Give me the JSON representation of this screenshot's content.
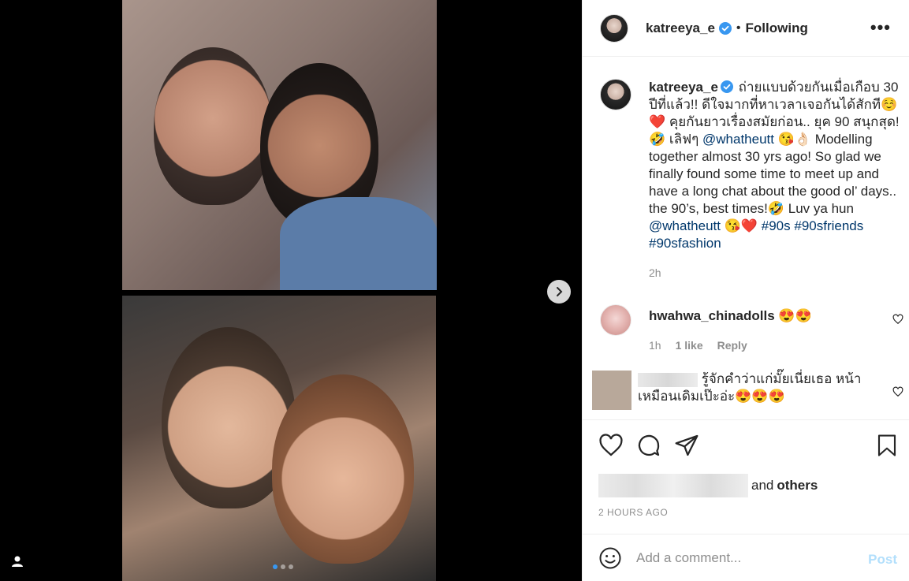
{
  "header": {
    "username": "katreeya_e",
    "separator": "•",
    "follow_status": "Following",
    "more": "•••"
  },
  "caption": {
    "username": "katreeya_e",
    "text_1": " ถ่ายแบบด้วยกันเมื่อเกือบ 30 ปีที่แล้ว!! ดีใจมากที่หาเวลาเจอกันได้สักที☺️❤️ คุยกันยาวเรื่องสมัยก่อน.. ยุค 90 สนุกสุด! 🤣 เลิฟๆ ",
    "mention_1": "@whatheutt",
    "text_2": " 😘👌🏻 Modelling together almost 30 yrs ago! So glad we finally found some time to meet up and have a long chat about the good ol’ days.. the 90’s, best times!🤣 Luv ya hun ",
    "mention_2": "@whatheutt",
    "text_3": " 😘❤️ ",
    "tag_1": "#90s",
    "tag_2": "#90sfriends",
    "tag_3": "#90sfashion",
    "time": "2h"
  },
  "comments": [
    {
      "username": "hwahwa_chinadolls",
      "text": " 😍😍",
      "time": "1h",
      "likes": "1 like",
      "reply": "Reply"
    },
    {
      "text": "รู้จักคำว่าแก่มั๊ยเนี่ยเธอ หน้าเหมือนเดิมเป๊ะอ่ะ😍😍😍"
    }
  ],
  "likes": {
    "suffix": "and",
    "others": "others"
  },
  "timestamp": "2 HOURS AGO",
  "add_comment": {
    "placeholder": "Add a comment...",
    "post_label": "Post"
  },
  "colors": {
    "link": "#00376b",
    "verified": "#3897f0",
    "post_disabled": "#b2dffc",
    "secondary_text": "#8e8e8e"
  },
  "icons": {
    "next": "chevron-right-icon",
    "tag_user": "user-icon",
    "like": "heart-icon",
    "comment": "comment-icon",
    "share": "paper-plane-icon",
    "save": "bookmark-icon",
    "emoji": "smiley-icon"
  }
}
